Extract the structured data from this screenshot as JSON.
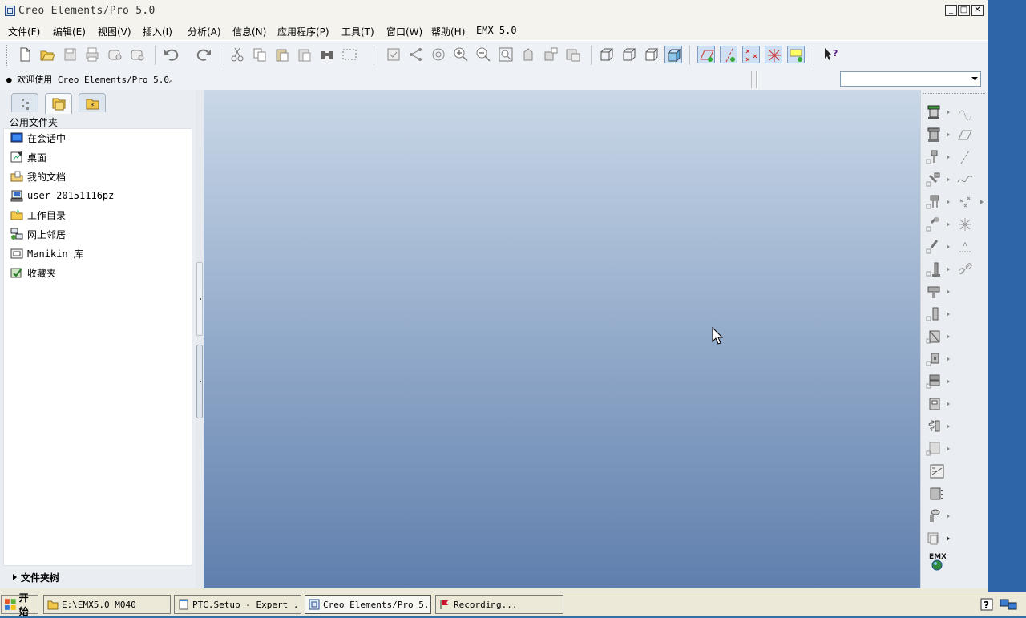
{
  "window": {
    "title": "Creo Elements/Pro 5.0"
  },
  "menubar": {
    "items": [
      "文件(F)",
      "编辑(E)",
      "视图(V)",
      "插入(I)",
      "分析(A)",
      "信息(N)",
      "应用程序(P)",
      "工具(T)",
      "窗口(W)",
      "帮助(H)",
      "EMX 5.0"
    ]
  },
  "toolbar": {
    "icons": [
      "new-file-icon",
      "open-file-icon",
      "save-icon",
      "print-icon",
      "send-mail-icon",
      "mail-icon",
      "undo-icon",
      "redo-icon",
      "cut-icon",
      "copy-icon",
      "paste-icon",
      "paste-special-icon",
      "find-icon",
      "select-box-icon",
      "regenerate-icon",
      "model-tree-icon",
      "repaint-icon",
      "zoom-in-icon",
      "zoom-out-icon",
      "refit-icon",
      "reorient-icon",
      "named-views-icon",
      "layers-icon",
      "wireframe-icon",
      "hidden-line-icon",
      "no-hidden-icon",
      "shading-icon",
      "datum-planes-icon",
      "datum-axes-icon",
      "datum-points-icon",
      "csys-icon",
      "annotations-icon",
      "context-help-icon"
    ]
  },
  "message_area": {
    "text": "欢迎使用 Creo Elements/Pro 5.0。",
    "dropdown_value": ""
  },
  "navigator": {
    "header": "公用文件夹",
    "folders": [
      {
        "label": "在会话中",
        "icon": "in-session-icon"
      },
      {
        "label": "桌面",
        "icon": "desktop-icon"
      },
      {
        "label": "我的文档",
        "icon": "my-documents-icon"
      },
      {
        "label": "user-20151116pz",
        "icon": "computer-icon"
      },
      {
        "label": "工作目录",
        "icon": "working-directory-icon"
      },
      {
        "label": "网上邻居",
        "icon": "network-icon"
      },
      {
        "label": "Manikin 库",
        "icon": "manikin-library-icon"
      },
      {
        "label": "收藏夹",
        "icon": "favorites-icon"
      }
    ],
    "tree_label": "文件夹树"
  },
  "right_toolbar": {
    "emx_label": "EMX"
  },
  "taskbar": {
    "start_label": "开始",
    "tasks": [
      {
        "label": "E:\\EMX5.0 M040",
        "icon": "folder-icon"
      },
      {
        "label": "PTC.Setup - Expert ...",
        "icon": "notepad-icon"
      },
      {
        "label": "Creo Elements/Pro 5.0",
        "icon": "creo-app-icon"
      },
      {
        "label": "Recording...",
        "icon": "recording-icon"
      }
    ]
  },
  "colors": {
    "graphics_top": "#cad8e8",
    "graphics_bottom": "#607fad",
    "desktop": "#2e64a8"
  }
}
